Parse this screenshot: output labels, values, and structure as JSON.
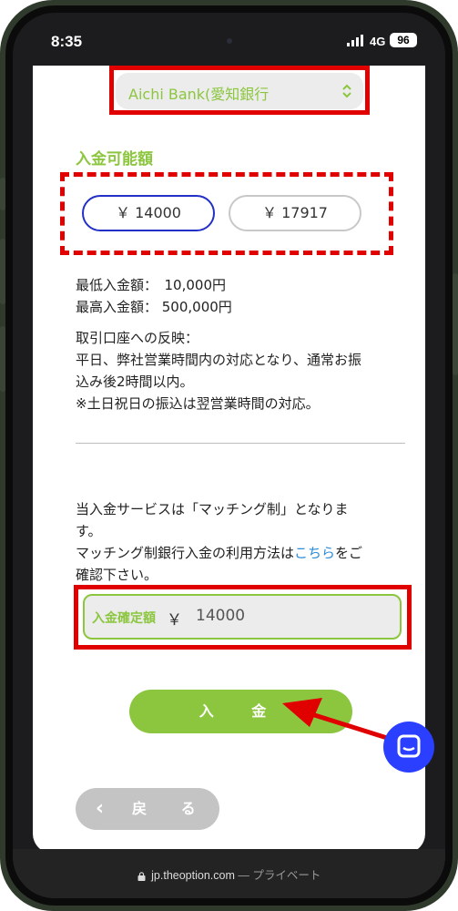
{
  "status_bar": {
    "time": "8:35",
    "network": "4G",
    "battery": "96"
  },
  "bank_select": {
    "label": "Aichi Bank(愛知銀行",
    "icon": "chevron-up-down-icon"
  },
  "section_title": "入金可能額",
  "amount_options": [
    {
      "label": "￥ 14000",
      "selected": true
    },
    {
      "label": "￥ 17917",
      "selected": false
    }
  ],
  "limits": {
    "min": "最低入金額：　10,000円",
    "max": "最高入金額：  500,000円"
  },
  "reflection_info": [
    "取引口座への反映：",
    "平日、弊社営業時間内の対応となり、通常お振",
    "込み後2時間以内。",
    "※土日祝日の振込は翌営業時間の対応。"
  ],
  "matching_info": {
    "line1": "当入金サービスは「マッチング制」となりま",
    "line2": "す。",
    "line3_prefix": "マッチング制銀行入金の利用方法は",
    "link_text": "こちら",
    "line3_suffix": "をご",
    "line4": "確認下さい。"
  },
  "confirm": {
    "label": "入金確定額",
    "currency": "￥",
    "value": "14000"
  },
  "deposit_button": "入 金",
  "back_button": {
    "icon_glyph": "‹",
    "label": "戻 る"
  },
  "chat_icon": "chat-icon",
  "url_bar": {
    "domain": "jp.theoption.com",
    "separator": " — ",
    "suffix": "プライベート"
  },
  "colors": {
    "accent_green": "#8cc63f",
    "highlight_red": "#e00000",
    "selected_border": "#2230c8",
    "link_blue": "#2a8bd6",
    "chat_blue": "#2a3fff"
  }
}
